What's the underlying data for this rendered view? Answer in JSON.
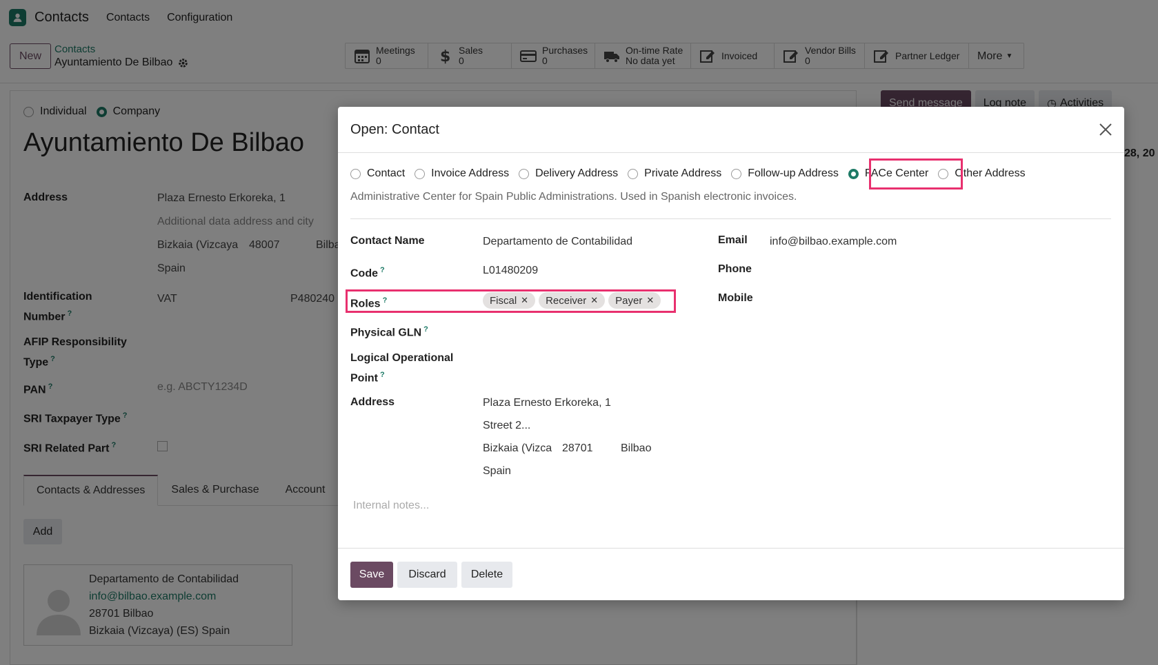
{
  "topnav": {
    "app_name": "Contacts",
    "menu": [
      "Contacts",
      "Configuration"
    ]
  },
  "control": {
    "new_label": "New",
    "breadcrumb_parent": "Contacts",
    "breadcrumb_current": "Ayuntamiento De Bilbao"
  },
  "smart_buttons": [
    {
      "label": "Meetings",
      "value": "0",
      "icon": "calendar-icon"
    },
    {
      "label": "Sales",
      "value": "0",
      "icon": "dollar-icon"
    },
    {
      "label": "Purchases",
      "value": "0",
      "icon": "credit-card-icon"
    },
    {
      "label": "On-time Rate",
      "value": "No data yet",
      "icon": "truck-icon"
    },
    {
      "label": "Invoiced",
      "value": "",
      "icon": "edit-icon"
    },
    {
      "label": "Vendor Bills",
      "value": "0",
      "icon": "edit-icon"
    },
    {
      "label": "Partner Ledger",
      "value": "",
      "icon": "edit-icon"
    },
    {
      "label": "More",
      "value": "",
      "icon": "caret-down-icon"
    }
  ],
  "form": {
    "type_individual": "Individual",
    "type_company": "Company",
    "name": "Ayuntamiento De Bilbao",
    "address_label": "Address",
    "street": "Plaza Ernesto Erkoreka, 1",
    "street2_placeholder": "Additional data address and city",
    "state": "Bizkaia (Vizcaya",
    "zip": "48007",
    "city": "Bilba",
    "country": "Spain",
    "id_label_1": "Identification",
    "id_label_2": "Number",
    "id_type": "VAT",
    "id_value": "P480240",
    "afip_label_1": "AFIP Responsibility",
    "afip_label_2": "Type",
    "pan_label": "PAN",
    "pan_placeholder": "e.g. ABCTY1234D",
    "sri_type_label": "SRI Taxpayer Type",
    "sri_related_label": "SRI Related Part",
    "tabs": [
      "Contacts & Addresses",
      "Sales & Purchase",
      "Account"
    ],
    "add_label": "Add",
    "kanban": {
      "name": "Departamento de Contabilidad",
      "email": "info@bilbao.example.com",
      "city_line": "28701 Bilbao",
      "region_line": "Bizkaia (Vizcaya) (ES) Spain"
    }
  },
  "chatter": {
    "send_message": "Send message",
    "log_note": "Log note",
    "activities": "Activities",
    "date_fragment": "28, 20"
  },
  "modal": {
    "title": "Open: Contact",
    "address_types": [
      "Contact",
      "Invoice Address",
      "Delivery Address",
      "Private Address",
      "Follow-up Address",
      "FACe Center",
      "Other Address"
    ],
    "selected_type": "FACe Center",
    "type_description": "Administrative Center for Spain Public Administrations. Used in Spanish electronic invoices.",
    "contact_name_label": "Contact Name",
    "contact_name": "Departamento de Contabilidad",
    "code_label": "Code",
    "code": "L01480209",
    "roles_label": "Roles",
    "roles": [
      "Fiscal",
      "Receiver",
      "Payer"
    ],
    "physical_gln_label": "Physical GLN",
    "logical_point_label_1": "Logical Operational",
    "logical_point_label_2": "Point",
    "address_label": "Address",
    "street": "Plaza Ernesto Erkoreka, 1",
    "street2_placeholder": "Street 2...",
    "state": "Bizkaia (Vizca",
    "zip": "28701",
    "city": "Bilbao",
    "country": "Spain",
    "email_label": "Email",
    "email": "info@bilbao.example.com",
    "phone_label": "Phone",
    "mobile_label": "Mobile",
    "notes_placeholder": "Internal notes...",
    "save_label": "Save",
    "discard_label": "Discard",
    "delete_label": "Delete"
  },
  "colors": {
    "brand": "#6b4a62",
    "accent": "#1d7a66",
    "highlight": "#e8306e"
  }
}
